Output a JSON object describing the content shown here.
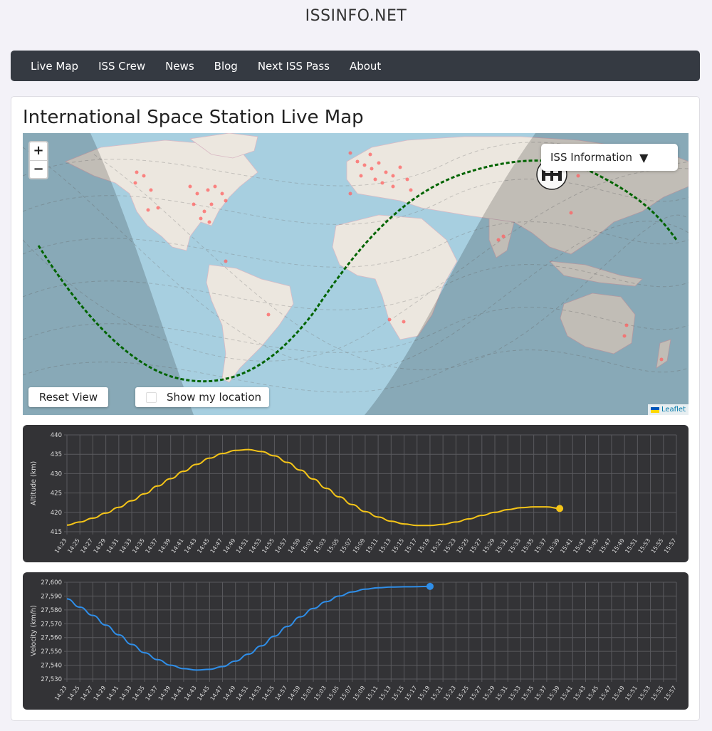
{
  "site": {
    "title": "ISSINFO.NET"
  },
  "nav": {
    "items": [
      "Live Map",
      "ISS Crew",
      "News",
      "Blog",
      "Next ISS Pass",
      "About"
    ]
  },
  "page": {
    "title": "International Space Station Live Map"
  },
  "map": {
    "zoom_in": "+",
    "zoom_out": "−",
    "iss_info_label": "ISS Information",
    "iss_info_arrow": "▼",
    "reset_label": "Reset View",
    "show_location_label": "Show my location",
    "attribution": "Leaflet",
    "track_color": "#006400"
  },
  "chart_data": [
    {
      "type": "line",
      "ylabel": "Altitude (km)",
      "yticks": [
        415,
        420,
        425,
        430,
        435,
        440
      ],
      "ylim": [
        415,
        440
      ],
      "x_labels": [
        "14:23",
        "14:25",
        "14:27",
        "14:29",
        "14:31",
        "14:33",
        "14:35",
        "14:37",
        "14:39",
        "14:41",
        "14:43",
        "14:45",
        "14:47",
        "14:49",
        "14:51",
        "14:53",
        "14:55",
        "14:57",
        "14:59",
        "15:01",
        "15:03",
        "15:05",
        "15:07",
        "15:09",
        "15:11",
        "15:13",
        "15:15",
        "15:17",
        "15:19",
        "15:21",
        "15:23",
        "15:25",
        "15:27",
        "15:29",
        "15:31",
        "15:33",
        "15:35",
        "15:37",
        "15:39",
        "15:41",
        "15:43",
        "15:45",
        "15:47",
        "15:49",
        "15:51",
        "15:53",
        "15:55",
        "15:57"
      ],
      "series": [
        {
          "color": "#f5c518",
          "values": [
            416.7,
            417.5,
            418.5,
            419.8,
            421.3,
            423.0,
            424.8,
            426.8,
            428.7,
            430.6,
            432.4,
            434.0,
            435.2,
            436.0,
            436.2,
            435.7,
            434.6,
            432.9,
            430.9,
            428.6,
            426.2,
            424.0,
            422.0,
            420.2,
            418.8,
            417.7,
            417.0,
            416.6,
            416.6,
            416.9,
            417.5,
            418.3,
            419.2,
            420.0,
            420.7,
            421.2,
            421.4,
            421.4,
            421.0
          ]
        }
      ]
    },
    {
      "type": "line",
      "ylabel": "Velocity (km/h)",
      "yticks": [
        "27,530",
        "27,540",
        "27,550",
        "27,560",
        "27,570",
        "27,580",
        "27,590",
        "27,600"
      ],
      "ylim": [
        27530,
        27600
      ],
      "x_labels": [
        "14:23",
        "14:25",
        "14:27",
        "14:29",
        "14:31",
        "14:33",
        "14:35",
        "14:37",
        "14:39",
        "14:41",
        "14:43",
        "14:45",
        "14:47",
        "14:49",
        "14:51",
        "14:53",
        "14:55",
        "14:57",
        "14:59",
        "15:01",
        "15:03",
        "15:05",
        "15:07",
        "15:09",
        "15:11",
        "15:13",
        "15:15",
        "15:17",
        "15:19",
        "15:21",
        "15:23",
        "15:25",
        "15:27",
        "15:29",
        "15:31",
        "15:33",
        "15:35",
        "15:37",
        "15:39",
        "15:41",
        "15:43",
        "15:45",
        "15:47",
        "15:49",
        "15:51",
        "15:53",
        "15:55",
        "15:57"
      ],
      "series": [
        {
          "color": "#2f8ee8",
          "values": [
            27588,
            27582,
            27576,
            27569,
            27562,
            27555,
            27549,
            27544,
            27540,
            27537.5,
            27536.5,
            27537,
            27539,
            27543,
            27548,
            27554,
            27561,
            27568,
            27575,
            27581,
            27586,
            27590,
            27593,
            27595,
            27596,
            27596.5,
            27596.7,
            27596.8,
            27597
          ]
        }
      ]
    }
  ]
}
